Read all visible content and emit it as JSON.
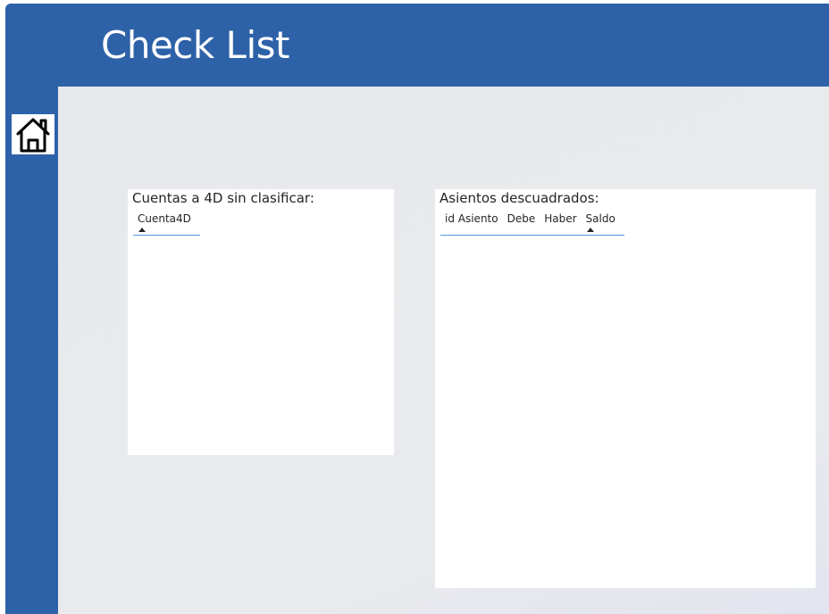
{
  "header": {
    "title": "Check List"
  },
  "nav": {
    "home_icon": "home-icon"
  },
  "panels": {
    "cuentas": {
      "title": "Cuentas a 4D sin clasificar:",
      "columns": [
        "Cuenta4D"
      ],
      "sorted_column": "Cuenta4D"
    },
    "asientos": {
      "title": "Asientos descuadrados:",
      "columns": [
        "id Asiento",
        "Debe",
        "Haber",
        "Saldo"
      ],
      "sorted_column": "Saldo"
    }
  },
  "colors": {
    "frame": "#2e62a8",
    "canvas": "#e8e9ec",
    "accent_line": "#4a9be8"
  }
}
